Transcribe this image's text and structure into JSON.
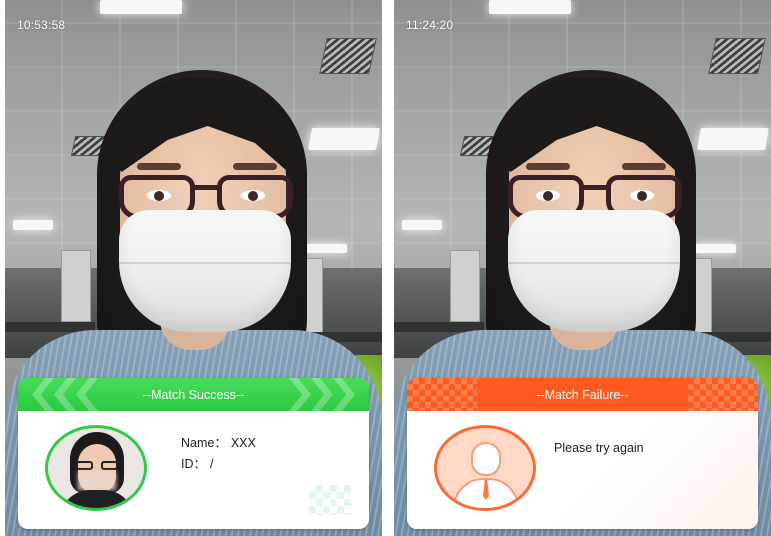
{
  "screens": [
    {
      "timestamp": "10:53:58",
      "result": {
        "status": "success",
        "header": "--Match Success--",
        "name_label": "Name：",
        "name_value": "XXX",
        "id_label": "ID：",
        "id_value": "/"
      }
    },
    {
      "timestamp": "11:24:20",
      "result": {
        "status": "failure",
        "header": "--Match Failure--",
        "message": "Please try again"
      }
    }
  ],
  "colors": {
    "success": "#2bc942",
    "failure": "#ff5a1f"
  },
  "icons": {
    "placeholder_avatar": "user-silhouette-icon"
  }
}
